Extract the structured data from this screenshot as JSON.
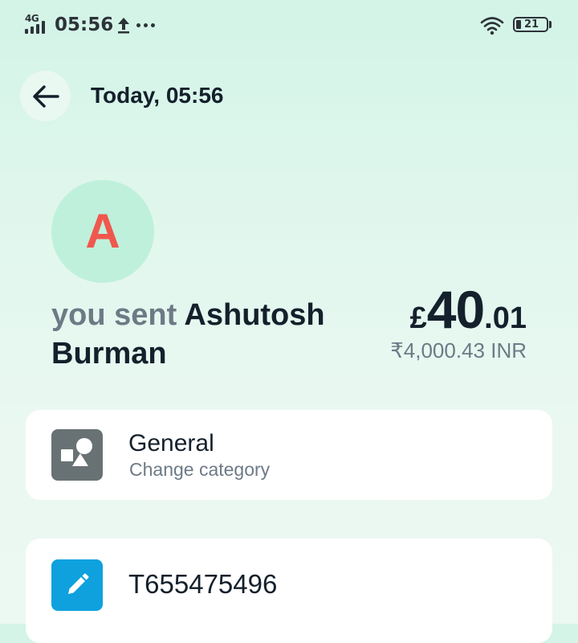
{
  "status_bar": {
    "network": "4G",
    "time": "05:56",
    "icons": [
      "signal-icon",
      "upload-icon",
      "more-dots-icon",
      "wifi-icon",
      "battery-icon"
    ],
    "battery_level": "21"
  },
  "header": {
    "back_icon": "arrow-left-icon",
    "title": "Today, 05:56"
  },
  "recipient": {
    "avatar_initial": "A",
    "sent_prefix": "you sent",
    "name": "Ashutosh Burman"
  },
  "amount": {
    "currency_symbol": "£",
    "major": "40",
    "minor": ".01",
    "converted": "₹4,000.43 INR"
  },
  "category_card": {
    "icon": "shapes-icon",
    "title": "General",
    "subtitle": "Change category"
  },
  "reference_card": {
    "icon": "pencil-icon",
    "reference": "T655475496"
  },
  "colors": {
    "background_top": "#d3f4e7",
    "background_bottom": "#ecf8f2",
    "avatar_bg": "#bff0dc",
    "avatar_initial": "#f0584d",
    "muted_text": "#6d7a86",
    "category_icon_bg": "#687274",
    "edit_icon_bg": "#0ea1de"
  }
}
